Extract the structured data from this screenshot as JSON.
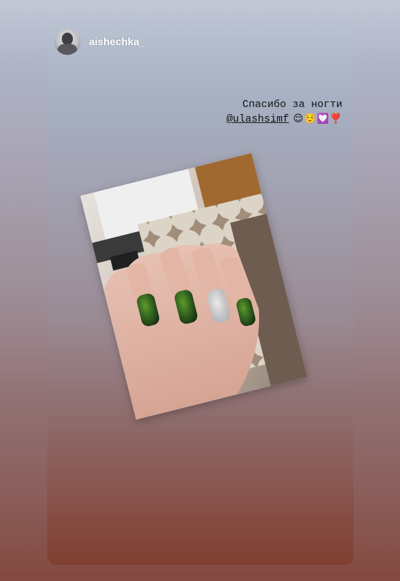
{
  "story": {
    "username": "aishechka_",
    "caption_line1": "Спасибо за ногти",
    "caption_mention": "@ulashsimf",
    "caption_emojis": "😌☺️💟❣️"
  },
  "colors": {
    "top": "#c3c8d7",
    "bottom": "#84493f",
    "nail_green": "#2e5d1e",
    "nail_silver": "#c9c9cc"
  },
  "icons": {
    "avatar": "profile-avatar",
    "photo": "nail-photo"
  }
}
